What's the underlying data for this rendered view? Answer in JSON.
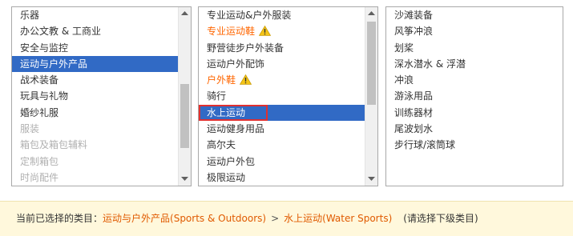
{
  "category_col1": {
    "items": [
      {
        "label": "乐器",
        "state": "normal"
      },
      {
        "label": "办公文教 & 工商业",
        "state": "normal"
      },
      {
        "label": "安全与监控",
        "state": "normal"
      },
      {
        "label": "运动与户外产品",
        "state": "selected"
      },
      {
        "label": "战术装备",
        "state": "normal"
      },
      {
        "label": "玩具与礼物",
        "state": "normal"
      },
      {
        "label": "婚纱礼服",
        "state": "normal"
      },
      {
        "label": "服装",
        "state": "disabled"
      },
      {
        "label": "箱包及箱包辅料",
        "state": "disabled"
      },
      {
        "label": "定制箱包",
        "state": "disabled"
      },
      {
        "label": "时尚配件",
        "state": "disabled"
      }
    ]
  },
  "category_col2": {
    "items": [
      {
        "label": "专业运动&户外服装",
        "state": "normal"
      },
      {
        "label": "专业运动鞋",
        "state": "warn"
      },
      {
        "label": "野营徒步户外装备",
        "state": "normal"
      },
      {
        "label": "运动户外配饰",
        "state": "normal"
      },
      {
        "label": "户外鞋",
        "state": "warn"
      },
      {
        "label": "骑行",
        "state": "normal"
      },
      {
        "label": "水上运动",
        "state": "selected"
      },
      {
        "label": "运动健身用品",
        "state": "normal"
      },
      {
        "label": "高尔夫",
        "state": "normal"
      },
      {
        "label": "运动户外包",
        "state": "normal"
      },
      {
        "label": "极限运动",
        "state": "normal"
      }
    ]
  },
  "category_col3": {
    "items": [
      {
        "label": "沙滩装备",
        "state": "normal"
      },
      {
        "label": "风筝冲浪",
        "state": "normal"
      },
      {
        "label": "划桨",
        "state": "normal"
      },
      {
        "label": "深水潜水 & 浮潜",
        "state": "normal"
      },
      {
        "label": "冲浪",
        "state": "normal"
      },
      {
        "label": "游泳用品",
        "state": "normal"
      },
      {
        "label": "训练器材",
        "state": "normal"
      },
      {
        "label": "尾波划水",
        "state": "normal"
      },
      {
        "label": "步行球/滚筒球",
        "state": "normal"
      }
    ]
  },
  "status": {
    "prefix": "当前已选择的类目：",
    "level1": "运动与户外产品(Sports & Outdoors)",
    "separator": ">",
    "level2": "水上运动(Water Sports)",
    "hint": "(请选择下级类目)"
  },
  "colors": {
    "selected_bg": "#316ac5",
    "warn_text": "#ff6600",
    "link_text": "#e05a00",
    "status_bg": "#fff8dc"
  },
  "icons": {
    "warning": "warning-triangle-icon"
  }
}
